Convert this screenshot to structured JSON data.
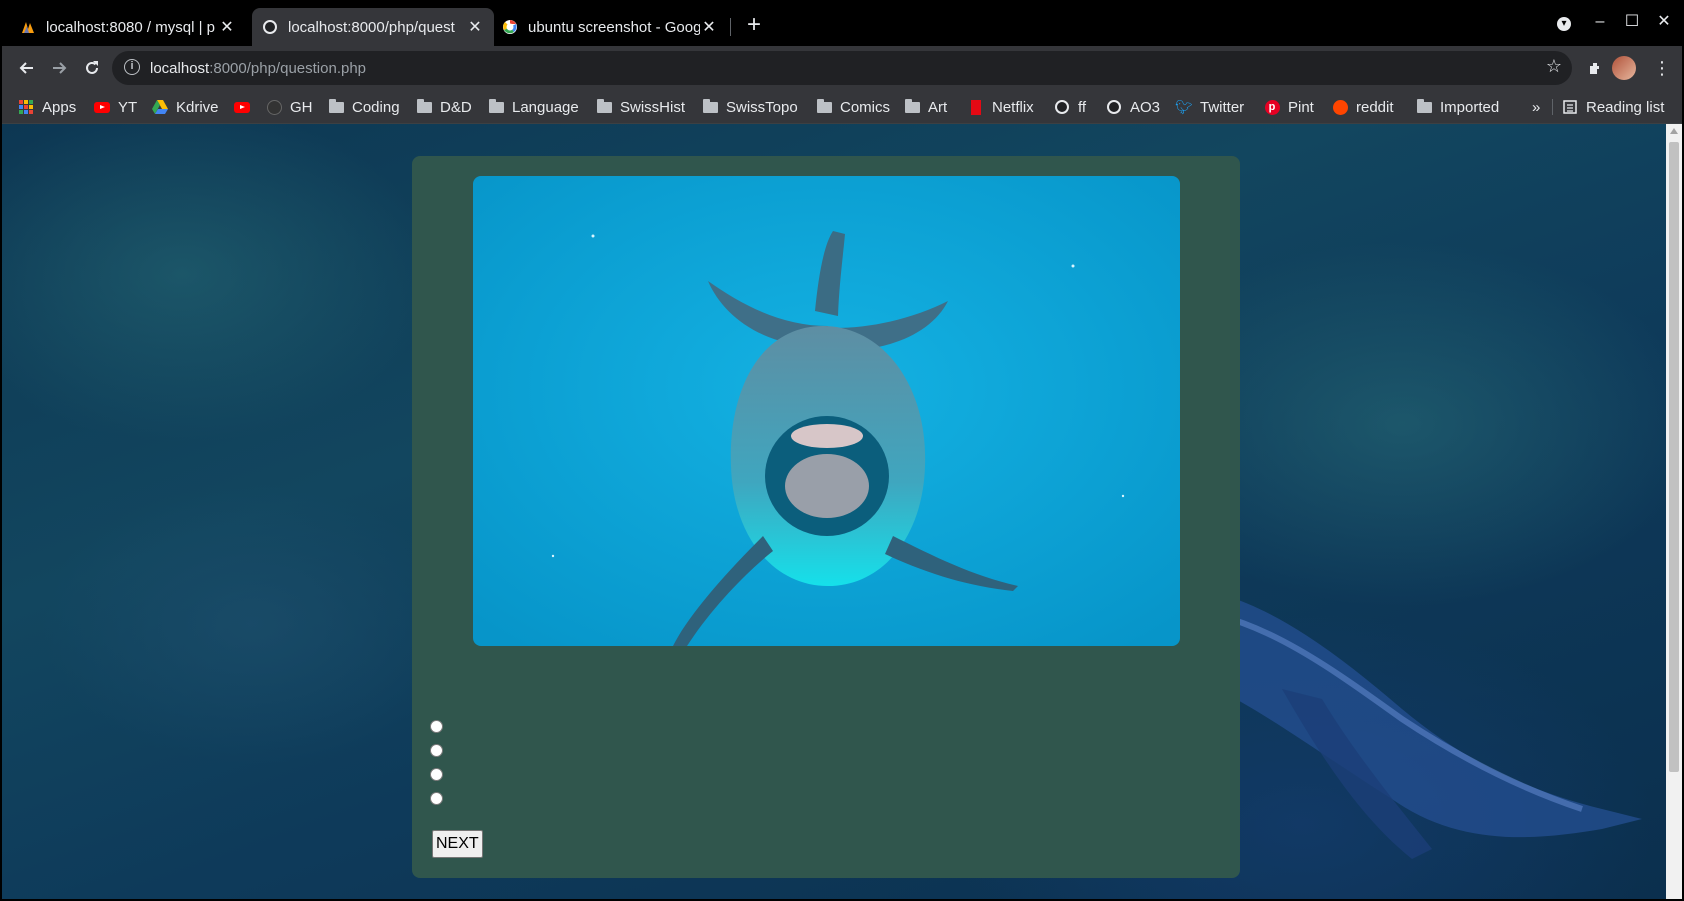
{
  "tabs": [
    {
      "title": "localhost:8080 / mysql | p",
      "icon": "phpmyadmin-icon",
      "active": false
    },
    {
      "title": "localhost:8000/php/quest",
      "icon": "globe-icon",
      "active": true
    },
    {
      "title": "ubuntu screenshot - Goog",
      "icon": "google-icon",
      "active": false
    }
  ],
  "tab_close": "✕",
  "new_tab": "+",
  "window_controls": {
    "minimize": "–",
    "maximize": "☐",
    "close": "✕",
    "profile_menu": "▾"
  },
  "address": {
    "host": "localhost",
    "rest": ":8000/php/question.php"
  },
  "bookmarks": [
    {
      "label": "Apps",
      "icon": "apps-icon"
    },
    {
      "label": "YT",
      "icon": "youtube-icon"
    },
    {
      "label": "Kdrive",
      "icon": "drive-icon"
    },
    {
      "label": "",
      "icon": "youtube-icon"
    },
    {
      "label": "GH",
      "icon": "github-icon"
    },
    {
      "label": "Coding",
      "icon": "folder-icon"
    },
    {
      "label": "D&D",
      "icon": "folder-icon"
    },
    {
      "label": "Language",
      "icon": "folder-icon"
    },
    {
      "label": "SwissHist",
      "icon": "folder-icon"
    },
    {
      "label": "SwissTopo",
      "icon": "folder-icon"
    },
    {
      "label": "Comics",
      "icon": "folder-icon"
    },
    {
      "label": "Art",
      "icon": "folder-icon"
    },
    {
      "label": "Netflix",
      "icon": "netflix-icon"
    },
    {
      "label": "ff",
      "icon": "globe-icon"
    },
    {
      "label": "AO3",
      "icon": "globe-icon"
    },
    {
      "label": "Twitter",
      "icon": "twitter-icon"
    },
    {
      "label": "Pint",
      "icon": "pinterest-icon"
    },
    {
      "label": "reddit",
      "icon": "reddit-icon"
    },
    {
      "label": "Imported",
      "icon": "folder-icon"
    }
  ],
  "bookmarks_overflow": "»",
  "reading_list": "Reading list",
  "quiz": {
    "image": "dolphin-photo",
    "options": [
      "",
      "",
      "",
      ""
    ],
    "next_label": "NEXT"
  },
  "colors": {
    "card": "#30564d",
    "accent": "#0ea2d4"
  }
}
